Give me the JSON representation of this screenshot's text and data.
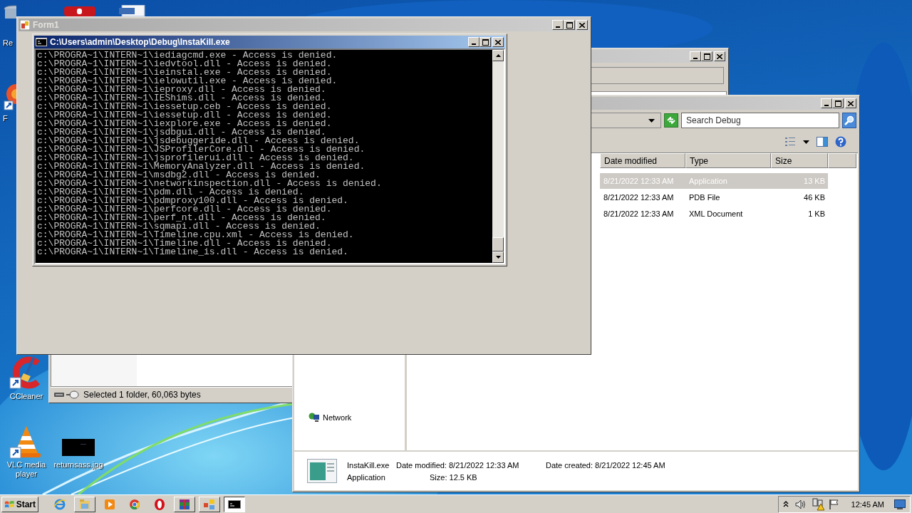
{
  "desktop_icons": [
    {
      "label": "Re",
      "kind": "recycle-bin"
    },
    {
      "label": "F",
      "kind": "shortcut"
    },
    {
      "label": "CCleaner",
      "kind": "ccleaner"
    },
    {
      "label": "VLC media player",
      "kind": "vlc"
    },
    {
      "label": "returnsass.jpg"
    }
  ],
  "background_window": {
    "status_text": "Selected 1 folder, 60,063 bytes"
  },
  "explorer": {
    "search": {
      "placeholder": "Search Debug"
    },
    "columns": [
      "Date modified",
      "Type",
      "Size"
    ],
    "rows": [
      {
        "date": "8/21/2022 12:33 AM",
        "type": "Application",
        "size": "13 KB",
        "selected": true
      },
      {
        "date": "8/21/2022 12:33 AM",
        "type": "PDB File",
        "size": "46 KB",
        "selected": false
      },
      {
        "date": "8/21/2022 12:33 AM",
        "type": "XML Document",
        "size": "1 KB",
        "selected": false
      }
    ],
    "nav_items": [
      "Network"
    ],
    "details": {
      "name": "InstaKill.exe",
      "type": "Application",
      "date_modified": "Date modified: 8/21/2022 12:33 AM",
      "date_created": "Date created: 8/21/2022 12:45 AM",
      "size": "Size: 12.5 KB"
    }
  },
  "form": {
    "title": "Form1"
  },
  "console": {
    "title": "C:\\Users\\admin\\Desktop\\Debug\\InstaKill.exe",
    "lines": [
      "c:\\PROGRA~1\\INTERN~1\\iediagcmd.exe - Access is denied.",
      "c:\\PROGRA~1\\INTERN~1\\iedvtool.dll - Access is denied.",
      "c:\\PROGRA~1\\INTERN~1\\ieinstal.exe - Access is denied.",
      "c:\\PROGRA~1\\INTERN~1\\ielowutil.exe - Access is denied.",
      "c:\\PROGRA~1\\INTERN~1\\ieproxy.dll - Access is denied.",
      "c:\\PROGRA~1\\INTERN~1\\IEShims.dll - Access is denied.",
      "c:\\PROGRA~1\\INTERN~1\\iessetup.ceb - Access is denied.",
      "c:\\PROGRA~1\\INTERN~1\\iessetup.dll - Access is denied.",
      "c:\\PROGRA~1\\INTERN~1\\iexplore.exe - Access is denied.",
      "c:\\PROGRA~1\\INTERN~1\\jsdbgui.dll - Access is denied.",
      "c:\\PROGRA~1\\INTERN~1\\jsdebuggeride.dll - Access is denied.",
      "c:\\PROGRA~1\\INTERN~1\\JSProfilerCore.dll - Access is denied.",
      "c:\\PROGRA~1\\INTERN~1\\jsprofilerui.dll - Access is denied.",
      "c:\\PROGRA~1\\INTERN~1\\MemoryAnalyzer.dll - Access is denied.",
      "c:\\PROGRA~1\\INTERN~1\\msdbg2.dll - Access is denied.",
      "c:\\PROGRA~1\\INTERN~1\\networkinspection.dll - Access is denied.",
      "c:\\PROGRA~1\\INTERN~1\\pdm.dll - Access is denied.",
      "c:\\PROGRA~1\\INTERN~1\\pdmproxy100.dll - Access is denied.",
      "c:\\PROGRA~1\\INTERN~1\\perfcore.dll - Access is denied.",
      "c:\\PROGRA~1\\INTERN~1\\perf_nt.dll - Access is denied.",
      "c:\\PROGRA~1\\INTERN~1\\sqmapi.dll - Access is denied.",
      "c:\\PROGRA~1\\INTERN~1\\Timeline.cpu.xml - Access is denied.",
      "c:\\PROGRA~1\\INTERN~1\\Timeline.dll - Access is denied.",
      "c:\\PROGRA~1\\INTERN~1\\Timeline_is.dll - Access is denied."
    ]
  },
  "taskbar": {
    "start": "Start",
    "apps": [
      {
        "kind": "ie",
        "open": false,
        "selected": false
      },
      {
        "kind": "explorer",
        "open": true,
        "selected": false
      },
      {
        "kind": "media",
        "open": false,
        "selected": false
      },
      {
        "kind": "chrome",
        "open": false,
        "selected": false
      },
      {
        "kind": "opera",
        "open": false,
        "selected": false
      },
      {
        "kind": "archive",
        "open": true,
        "selected": false
      },
      {
        "kind": "network",
        "open": true,
        "selected": false
      },
      {
        "kind": "cmd",
        "open": true,
        "selected": true
      }
    ],
    "clock": "12:45 AM"
  }
}
